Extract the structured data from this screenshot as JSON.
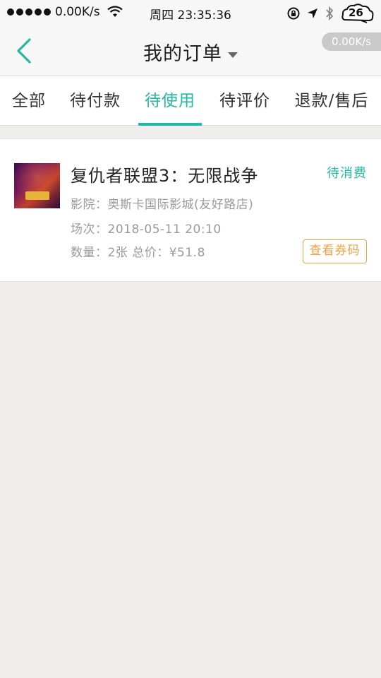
{
  "status_bar": {
    "speed": "0.00K/s",
    "time": "周四 23:35:36",
    "badge": "26"
  },
  "navbar": {
    "title": "我的订单",
    "speed_pill": "0.00K/s"
  },
  "tabs": [
    {
      "label": "全部"
    },
    {
      "label": "待付款"
    },
    {
      "label": "待使用",
      "active": true
    },
    {
      "label": "待评价"
    },
    {
      "label": "退款/售后"
    }
  ],
  "order": {
    "movie_title": "复仇者联盟3：无限战争",
    "status": "待消费",
    "cinema": "影院：奥斯卡国际影城(友好路店)",
    "session": "场次：2018-05-11 20:10",
    "quantity_total": "数量：2张  总价：¥51.8",
    "voucher_button": "查看券码"
  },
  "colors": {
    "accent": "#1fbaa4",
    "warning": "#f0a043",
    "background": "#efeeec"
  }
}
